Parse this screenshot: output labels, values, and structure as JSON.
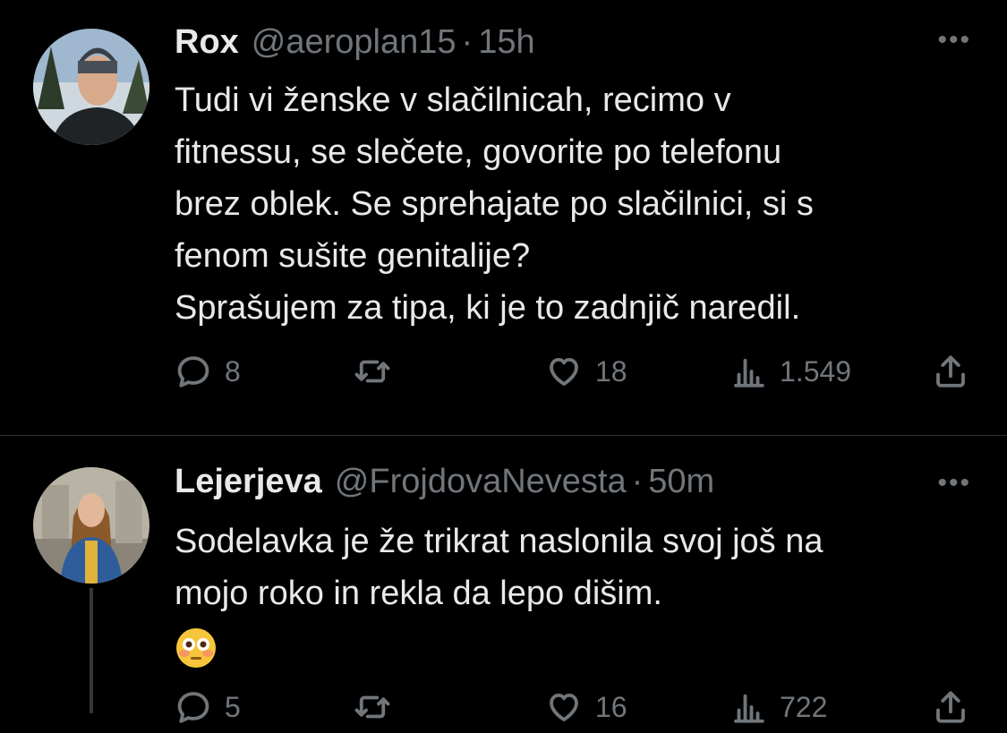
{
  "tweets": [
    {
      "name": "Rox",
      "handle": "@aeroplan15",
      "separator": "·",
      "time": "15h",
      "text_lines": [
        "Tudi vi ženske v slačilnicah, recimo v",
        "fitnessu, se slečete, govorite po telefonu",
        "brez oblek. Se sprehajate po slačilnici, si s",
        "fenom sušite genitalije?",
        "Sprašujem za tipa, ki je to zadnjič naredil."
      ],
      "replies": "8",
      "likes": "18",
      "views": "1.549",
      "more": "•••"
    },
    {
      "name": "Lejerjeva",
      "handle": "@FrojdovaNevesta",
      "separator": "·",
      "time": "50m",
      "text_lines": [
        "Sodelavka je že trikrat naslonila svoj još na",
        "mojo roko in rekla da lepo dišim."
      ],
      "emoji": "flushed-face-emoji",
      "replies": "5",
      "likes": "16",
      "views": "722",
      "more": "•••"
    }
  ],
  "colors": {
    "background": "#000000",
    "text": "#e7e9ea",
    "muted": "#71767b",
    "divider": "#2f3336"
  }
}
